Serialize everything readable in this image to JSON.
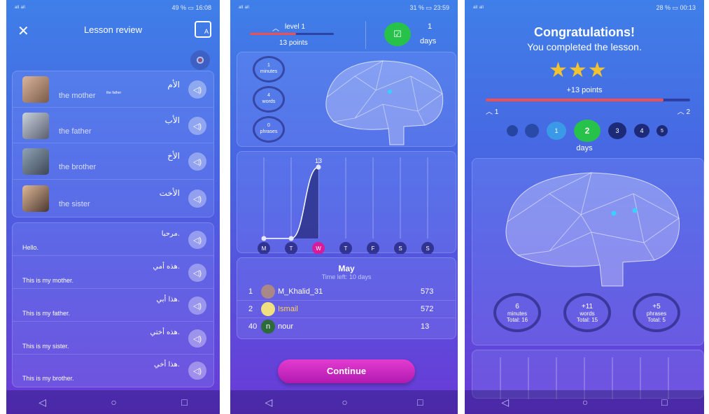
{
  "screen1": {
    "status_left": "ᵃˡˡ ᵃˡˡ",
    "status_right": "49 % ▭ 16:08",
    "title": "Lesson review",
    "words": [
      {
        "en": "the mother",
        "ar": "الأم"
      },
      {
        "en": "the father",
        "ar": "الأب"
      },
      {
        "en": "the brother",
        "ar": "الأخ"
      },
      {
        "en": "the sister",
        "ar": "الأخت"
      }
    ],
    "overlay_label": "the father",
    "sentences": [
      {
        "en": "Hello.",
        "ar": "مرحبا."
      },
      {
        "en": "This is my mother.",
        "ar": "هذه أمي."
      },
      {
        "en": "This is my father.",
        "ar": "هذا أبي."
      },
      {
        "en": "This is my sister.",
        "ar": "هذه أختي."
      },
      {
        "en": "This is my brother.",
        "ar": "هذا أخي."
      }
    ]
  },
  "screen2": {
    "status_left": "ᵃˡˡ ᵃˡˡ",
    "status_right": "31 % ▭ 23:59",
    "level": "level 1",
    "points": "13 points",
    "level_progress": 0.55,
    "days_count": "1",
    "days_label": "days",
    "stats": [
      {
        "value": "1",
        "label": "minutes"
      },
      {
        "value": "4",
        "label": "words"
      },
      {
        "value": "0",
        "label": "phrases"
      }
    ],
    "chart_data": {
      "type": "area",
      "categories": [
        "M",
        "T",
        "W",
        "T",
        "F",
        "S",
        "S"
      ],
      "values": [
        0,
        0,
        13,
        null,
        null,
        null,
        null
      ],
      "highlight_index": 2,
      "data_labels": [
        "13"
      ]
    },
    "leaderboard": {
      "month": "May",
      "time_left": "Time left: 10 days",
      "rows": [
        {
          "rank": "1",
          "name": "M_Khalid_31",
          "score": "573"
        },
        {
          "rank": "2",
          "name": "Ismail",
          "score": "572"
        },
        {
          "rank": "40",
          "avatar": "n",
          "name": "nour",
          "score": "13"
        }
      ]
    },
    "continue_label": "Continue"
  },
  "screen3": {
    "status_left": "ᵃˡˡ ᵃˡˡ",
    "status_right": "28 % ▭ 00:13",
    "congrats": "Congratulations!",
    "subtitle": "You completed the lesson.",
    "stars": 3,
    "points": "+13 points",
    "progress": 0.87,
    "level_from": "1",
    "level_to": "2",
    "streak": [
      "1",
      "2",
      "3",
      "4",
      "5"
    ],
    "current_day": "2",
    "days_label": "days",
    "stats": [
      {
        "value": "6",
        "label": "minutes",
        "total": "Total: 16"
      },
      {
        "value": "+11",
        "label": "words",
        "total": "Total: 15"
      },
      {
        "value": "+5",
        "label": "phrases",
        "total": "Total: 5"
      }
    ]
  },
  "colors": {
    "accent": "#d81b9a",
    "progress": "#f05050",
    "green": "#26c24a"
  }
}
